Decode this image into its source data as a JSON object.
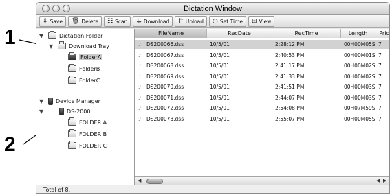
{
  "callouts": [
    "1",
    "2"
  ],
  "window": {
    "title": "Dictation Window"
  },
  "toolbar": [
    {
      "label": "Save",
      "icon": "save-icon",
      "glyph": "⇩"
    },
    {
      "label": "Delete",
      "icon": "trash-icon",
      "glyph": "🗑"
    },
    {
      "label": "Scan",
      "icon": "scan-icon",
      "glyph": "☷"
    },
    {
      "label": "Download",
      "icon": "download-icon",
      "glyph": "⇊"
    },
    {
      "label": "Upload",
      "icon": "upload-icon",
      "glyph": "⇈"
    },
    {
      "label": "Set Time",
      "icon": "clock-icon",
      "glyph": "◷"
    },
    {
      "label": "View",
      "icon": "view-icon",
      "glyph": "⊞"
    }
  ],
  "sidebar": {
    "dictation_folder": "Dictation Folder",
    "download_tray": "Download Tray",
    "folders": [
      "FolderA",
      "FolderB",
      "FolderC"
    ],
    "device_manager": "Device Manager",
    "device": "DS-2000",
    "device_folders": [
      "FOLDER A",
      "FOLDER B",
      "FOLDER C"
    ]
  },
  "table": {
    "columns": [
      "FileName",
      "RecDate",
      "RecTime",
      "Length",
      "Priority"
    ],
    "rows": [
      [
        "DS200066.dss",
        "10/5/01",
        "2:28:12 PM",
        "00H00M05S",
        "7"
      ],
      [
        "DS200067.dss",
        "10/5/01",
        "2:40:53 PM",
        "00H00M01S",
        "7"
      ],
      [
        "DS200068.dss",
        "10/5/01",
        "2:41:17 PM",
        "00H00M02S",
        "7"
      ],
      [
        "DS200069.dss",
        "10/5/01",
        "2:41:33 PM",
        "00H00M02S",
        "7"
      ],
      [
        "DS200070.dss",
        "10/5/01",
        "2:41:51 PM",
        "00H00M03S",
        "7"
      ],
      [
        "DS200071.dss",
        "10/5/01",
        "2:44:07 PM",
        "00H00M03S",
        "7"
      ],
      [
        "DS200072.dss",
        "10/5/01",
        "2:54:08 PM",
        "00H07M59S",
        "7"
      ],
      [
        "DS200073.dss",
        "10/5/01",
        "2:55:07 PM",
        "00H00M05S",
        "7"
      ]
    ]
  },
  "status": {
    "text": "Total of 8."
  }
}
